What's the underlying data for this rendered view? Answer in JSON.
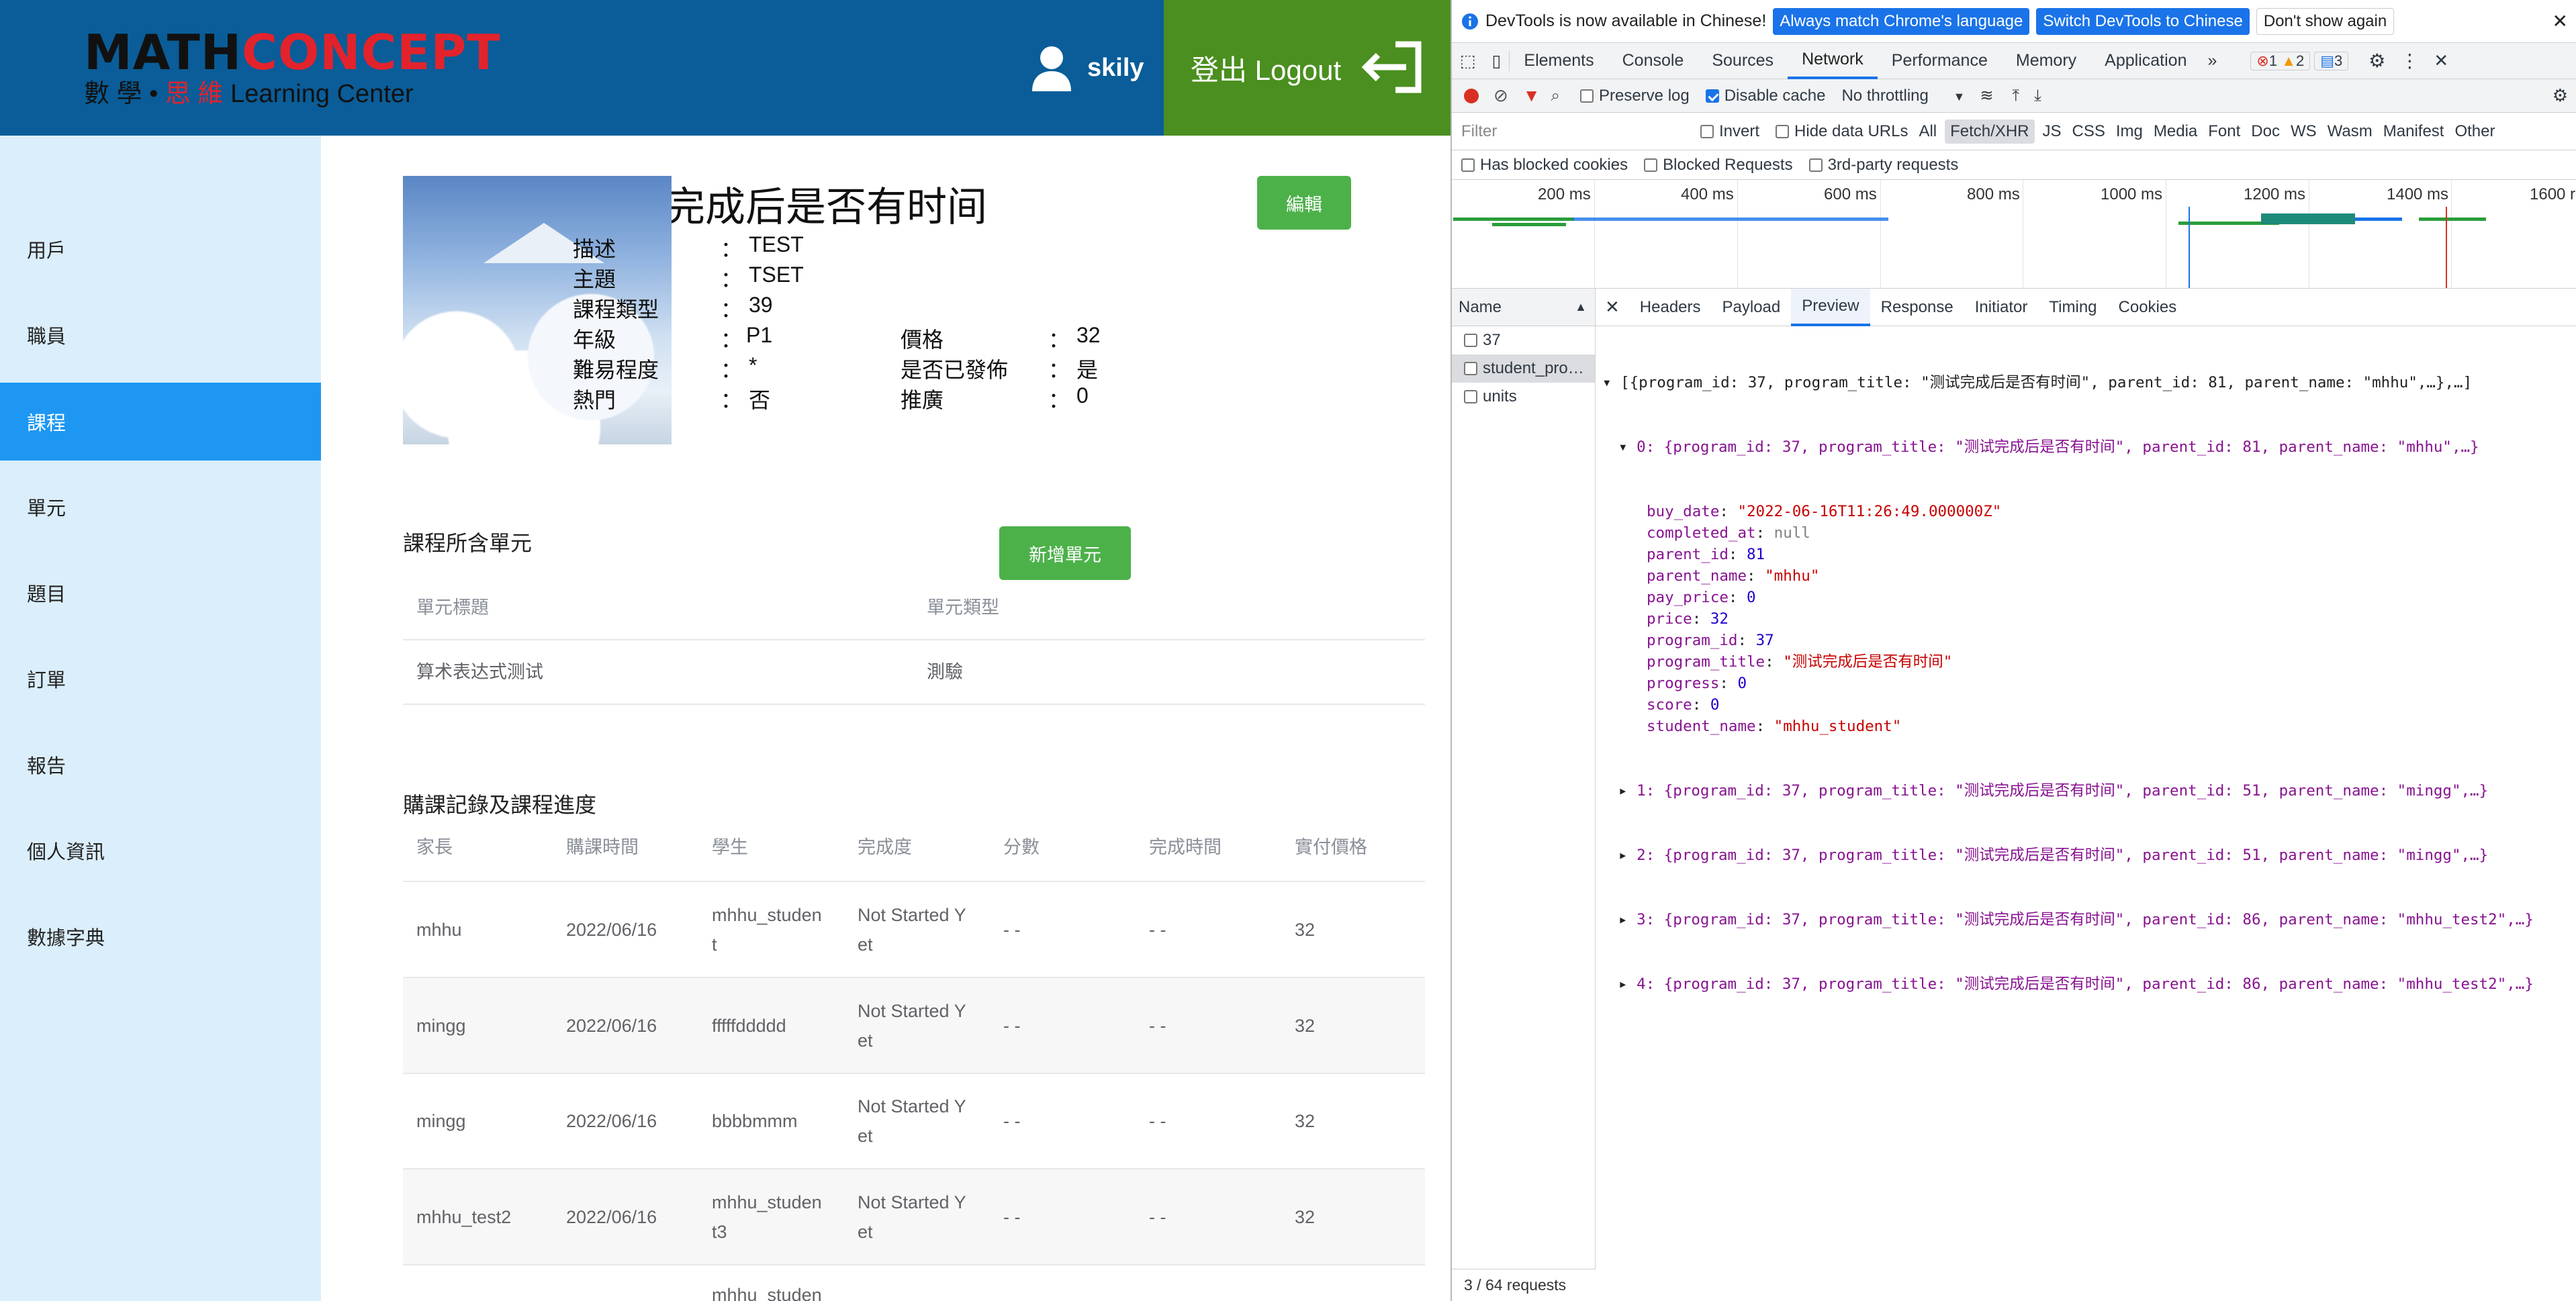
{
  "header": {
    "logo_part1": "MATH",
    "logo_part2": "CONCEPT",
    "logo_sub_chinese1": "數 學 •",
    "logo_sub_chinese2": "思 維",
    "logo_sub_english": "Learning Center",
    "username": "skily",
    "logout_label": "登出 Logout",
    "brand_blue": "#0a5d98",
    "logout_green": "#4a8f1f"
  },
  "sidebar": {
    "items": [
      {
        "label": "用戶"
      },
      {
        "label": "職員"
      },
      {
        "label": "課程"
      },
      {
        "label": "單元"
      },
      {
        "label": "題目"
      },
      {
        "label": "訂單"
      },
      {
        "label": "報告"
      },
      {
        "label": "個人資訊"
      },
      {
        "label": "數據字典"
      }
    ],
    "active": "課程",
    "active_color": "#1d97f2"
  },
  "program": {
    "title": "完成后是否有时间",
    "edit_label": "編輯",
    "fields": {
      "description_label": "描述",
      "description_value": "TEST",
      "subject_label": "主題",
      "subject_value": "TSET",
      "type_label": "課程類型",
      "type_value": "39",
      "grade_label": "年級",
      "grade_value": "P1",
      "difficulty_label": "難易程度",
      "difficulty_value": "*",
      "hot_label": "熱門",
      "hot_value": "否",
      "price_label": "價格",
      "price_value": "32",
      "published_label": "是否已發佈",
      "published_value": "是",
      "promotion_label": "推廣",
      "promotion_value": "0"
    },
    "colon": "："
  },
  "units": {
    "section_title": "課程所含單元",
    "add_label": "新增單元",
    "headers": [
      "單元標題",
      "單元類型"
    ],
    "rows": [
      [
        "算术表达式测试",
        "測驗"
      ]
    ]
  },
  "purchases": {
    "section_title": "購課記錄及課程進度",
    "headers": [
      "家長",
      "購課時間",
      "學生",
      "完成度",
      "分數",
      "完成時間",
      "實付價格"
    ],
    "rows": [
      {
        "parent": "mhhu",
        "date": "2022/06/16",
        "student1": "mhhu_studen",
        "student2": "t",
        "progress1": "Not Started Y",
        "progress2": "et",
        "score": "- -",
        "completed": "- -",
        "paid": "32"
      },
      {
        "parent": "mingg",
        "date": "2022/06/16",
        "student1": "fffffddddd",
        "student2": "",
        "progress1": "Not Started Y",
        "progress2": "et",
        "score": "- -",
        "completed": "- -",
        "paid": "32"
      },
      {
        "parent": "mingg",
        "date": "2022/06/16",
        "student1": "bbbbmmm",
        "student2": "",
        "progress1": "Not Started Y",
        "progress2": "et",
        "score": "- -",
        "completed": "- -",
        "paid": "32"
      },
      {
        "parent": "mhhu_test2",
        "date": "2022/06/16",
        "student1": "mhhu_studen",
        "student2": "t3",
        "progress1": "Not Started Y",
        "progress2": "et",
        "score": "- -",
        "completed": "- -",
        "paid": "32"
      },
      {
        "parent": "",
        "date": "",
        "student1": "mhhu_studen",
        "student2": "",
        "progress1": "",
        "progress2": "",
        "score": "",
        "completed": "",
        "paid": ""
      }
    ]
  },
  "devtools": {
    "infobar": {
      "message": "DevTools is now available in Chinese!",
      "btn1": "Always match Chrome's language",
      "btn2": "Switch DevTools to Chinese",
      "btn3": "Don't show again"
    },
    "tabs": [
      "Elements",
      "Console",
      "Sources",
      "Network",
      "Performance",
      "Memory",
      "Application"
    ],
    "active_tab": "Network",
    "more_tabs": "»",
    "badges": {
      "errors": "1",
      "warnings": "2",
      "messages": "3"
    },
    "toolbar": {
      "preserve_log": "Preserve log",
      "disable_cache": "Disable cache",
      "throttling": "No throttling"
    },
    "filter": {
      "placeholder": "Filter",
      "invert": "Invert",
      "hide_data_urls": "Hide data URLs",
      "types": [
        "All",
        "Fetch/XHR",
        "JS",
        "CSS",
        "Img",
        "Media",
        "Font",
        "Doc",
        "WS",
        "Wasm",
        "Manifest",
        "Other"
      ],
      "active_type": "Fetch/XHR"
    },
    "blocked": {
      "has_blocked_cookies": "Has blocked cookies",
      "blocked_requests": "Blocked Requests",
      "third_party": "3rd-party requests"
    },
    "timeline_ticks": [
      "200 ms",
      "400 ms",
      "600 ms",
      "800 ms",
      "1000 ms",
      "1200 ms",
      "1400 ms",
      "1600 r"
    ],
    "requests": {
      "header": "Name",
      "items": [
        "37",
        "student_pro…",
        "units"
      ],
      "selected": "student_pro…",
      "footer": "3 / 64 requests"
    },
    "detail_tabs": [
      "Headers",
      "Payload",
      "Preview",
      "Response",
      "Initiator",
      "Timing",
      "Cookies"
    ],
    "active_detail_tab": "Preview",
    "preview": {
      "root": "[{program_id: 37, program_title: \"测试完成后是否有时间\", parent_id: 81, parent_name: \"mhhu\",…},…]",
      "item0": "0: {program_id: 37, program_title: \"测试完成后是否有时间\", parent_id: 81, parent_name: \"mhhu\",…}",
      "fields": [
        {
          "key": "buy_date",
          "value": "\"2022-06-16T11:26:49.000000Z\"",
          "kind": "s"
        },
        {
          "key": "completed_at",
          "value": "null",
          "kind": "nl"
        },
        {
          "key": "parent_id",
          "value": "81",
          "kind": "n"
        },
        {
          "key": "parent_name",
          "value": "\"mhhu\"",
          "kind": "s"
        },
        {
          "key": "pay_price",
          "value": "0",
          "kind": "n"
        },
        {
          "key": "price",
          "value": "32",
          "kind": "n"
        },
        {
          "key": "program_id",
          "value": "37",
          "kind": "n"
        },
        {
          "key": "program_title",
          "value": "\"测试完成后是否有时间\"",
          "kind": "s"
        },
        {
          "key": "progress",
          "value": "0",
          "kind": "n"
        },
        {
          "key": "score",
          "value": "0",
          "kind": "n"
        },
        {
          "key": "student_name",
          "value": "\"mhhu_student\"",
          "kind": "s"
        }
      ],
      "collapsed": [
        "1: {program_id: 37, program_title: \"测试完成后是否有时间\", parent_id: 51, parent_name: \"mingg\",…}",
        "2: {program_id: 37, program_title: \"测试完成后是否有时间\", parent_id: 51, parent_name: \"mingg\",…}",
        "3: {program_id: 37, program_title: \"测试完成后是否有时间\", parent_id: 86, parent_name: \"mhhu_test2\",…}",
        "4: {program_id: 37, program_title: \"测试完成后是否有时间\", parent_id: 86, parent_name: \"mhhu_test2\",…}"
      ]
    }
  }
}
